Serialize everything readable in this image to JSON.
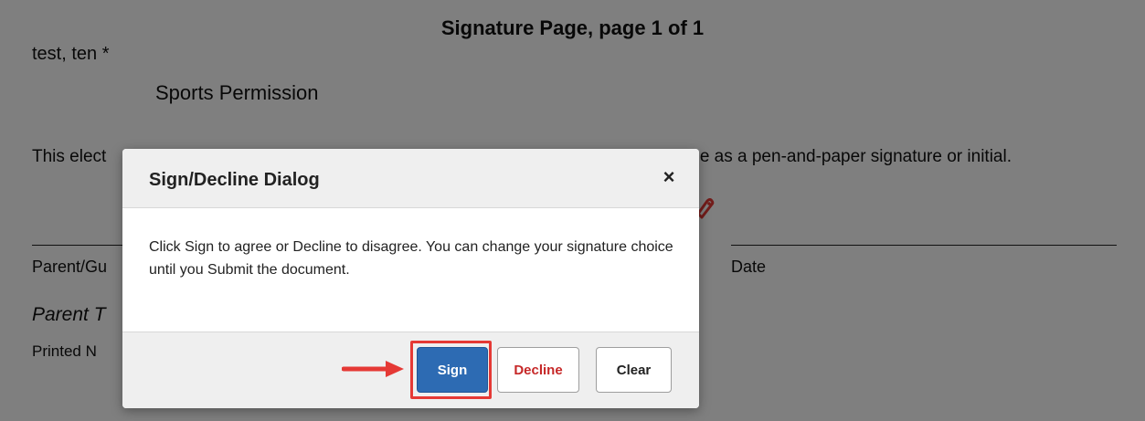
{
  "document": {
    "title": "Signature Page, page 1 of 1",
    "student_name": "test, ten *",
    "form_title": "Sports Permission",
    "disclaimer_left": "This elect",
    "disclaimer_right": "me as a pen-and-paper signature or initial.",
    "signature_label": "Parent/Gu",
    "date_label": "Date",
    "parent_name": "Parent T",
    "printed_label": "Printed N"
  },
  "dialog": {
    "title": "Sign/Decline Dialog",
    "close_symbol": "×",
    "body_text": "Click Sign to agree or Decline to disagree. You can change your signature choice until you Submit the document.",
    "buttons": {
      "sign": "Sign",
      "decline": "Decline",
      "clear": "Clear"
    }
  },
  "colors": {
    "sign_button": "#2d6bb3",
    "decline_text": "#c62828",
    "highlight": "#e53935",
    "arrow": "#e53935"
  },
  "icons": {
    "signature_marker": "pen-tag-icon",
    "pointer": "arrow-right-icon"
  }
}
